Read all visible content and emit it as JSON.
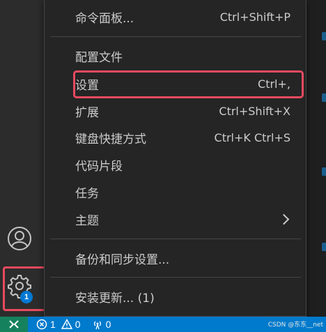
{
  "menu": {
    "items": [
      {
        "label": "命令面板...",
        "shortcut": "Ctrl+Shift+P"
      },
      {
        "label": "配置文件",
        "shortcut": ""
      },
      {
        "label": "设置",
        "shortcut": "Ctrl+,"
      },
      {
        "label": "扩展",
        "shortcut": "Ctrl+Shift+X"
      },
      {
        "label": "键盘快捷方式",
        "shortcut": "Ctrl+K Ctrl+S"
      },
      {
        "label": "代码片段",
        "shortcut": ""
      },
      {
        "label": "任务",
        "shortcut": ""
      },
      {
        "label": "主题",
        "shortcut": ""
      },
      {
        "label": "备份和同步设置...",
        "shortcut": ""
      },
      {
        "label": "安装更新... (1)",
        "shortcut": ""
      }
    ]
  },
  "activity_bar": {
    "account_icon": "account-icon",
    "manage_icon": "gear-icon",
    "manage_badge": "1"
  },
  "status_bar": {
    "errors": "1",
    "warnings": "0",
    "ports": "0"
  },
  "watermark": "CSDN @东东__net",
  "colors": {
    "highlight": "#e94a5f",
    "status_bar": "#007acc",
    "remote": "#16825d",
    "badge": "#0078d4"
  }
}
